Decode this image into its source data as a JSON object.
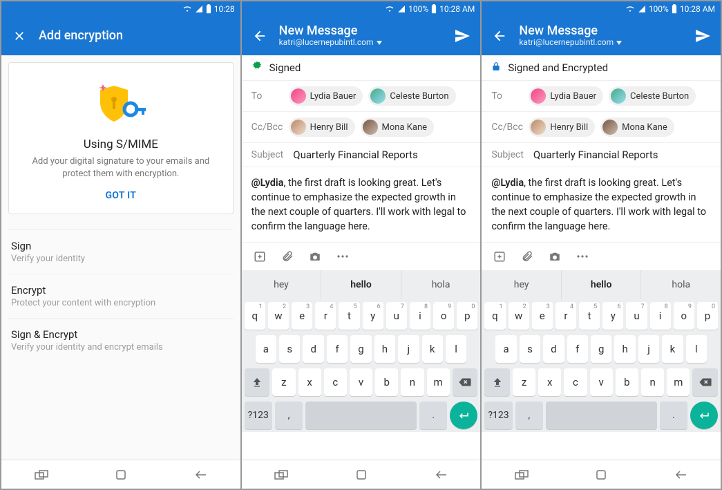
{
  "screen1": {
    "status": {
      "time": "10:28"
    },
    "appbar": {
      "title": "Add encryption"
    },
    "card": {
      "title": "Using S/MIME",
      "subtitle": "Add your digital signature to your emails and protect them with encryption.",
      "button": "GOT IT"
    },
    "options": [
      {
        "title": "Sign",
        "subtitle": "Verify your identity"
      },
      {
        "title": "Encrypt",
        "subtitle": "Protect your content with encryption"
      },
      {
        "title": "Sign & Encrypt",
        "subtitle": "Verify your identity and encrypt emails"
      }
    ]
  },
  "screen2": {
    "status": {
      "battery": "100%",
      "time": "10:28 AM"
    },
    "appbar": {
      "title": "New Message",
      "account": "katri@lucernepubintl.com"
    },
    "security_label": "Signed",
    "to_label": "To",
    "to": [
      {
        "name": "Lydia Bauer"
      },
      {
        "name": "Celeste Burton"
      }
    ],
    "cc_label": "Cc/Bcc",
    "cc": [
      {
        "name": "Henry Bill"
      },
      {
        "name": "Mona Kane"
      }
    ],
    "subject_label": "Subject",
    "subject": "Quarterly Financial Reports",
    "body_mention": "@Lydia",
    "body_rest": ", the first draft is looking great. Let's continue to emphasize the expected growth in the next couple of quarters. I'll work with legal to confirm the language here.",
    "suggestions": [
      "hey",
      "hello",
      "hola"
    ],
    "numsym_key": "?123"
  },
  "screen3": {
    "status": {
      "battery": "100%",
      "time": "10:28 AM"
    },
    "appbar": {
      "title": "New Message",
      "account": "katri@lucernepubintl.com"
    },
    "security_label": "Signed and Encrypted",
    "to_label": "To",
    "to": [
      {
        "name": "Lydia Bauer"
      },
      {
        "name": "Celeste Burton"
      }
    ],
    "cc_label": "Cc/Bcc",
    "cc": [
      {
        "name": "Henry Bill"
      },
      {
        "name": "Mona Kane"
      }
    ],
    "subject_label": "Subject",
    "subject": "Quarterly Financial Reports",
    "body_mention": "@Lydia",
    "body_rest": ", the first draft is looking great. Let's continue to emphasize the expected growth in the next couple of quarters. I'll work with legal to confirm the language here.",
    "suggestions": [
      "hey",
      "hello",
      "hola"
    ],
    "numsym_key": "?123"
  },
  "keyboard_rows": {
    "row1": [
      {
        "k": "q",
        "s": "1"
      },
      {
        "k": "w",
        "s": "2"
      },
      {
        "k": "e",
        "s": "3"
      },
      {
        "k": "r",
        "s": "4"
      },
      {
        "k": "t",
        "s": "5"
      },
      {
        "k": "y",
        "s": "6"
      },
      {
        "k": "u",
        "s": "7"
      },
      {
        "k": "i",
        "s": "8"
      },
      {
        "k": "o",
        "s": "9"
      },
      {
        "k": "p",
        "s": "0"
      }
    ],
    "row2": [
      "a",
      "s",
      "d",
      "f",
      "g",
      "h",
      "j",
      "k",
      "l"
    ],
    "row3": [
      "z",
      "x",
      "c",
      "v",
      "b",
      "n",
      "m"
    ]
  }
}
